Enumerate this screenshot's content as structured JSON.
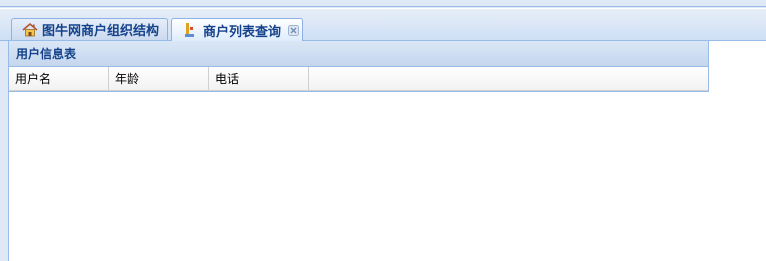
{
  "tabs": [
    {
      "label": "图牛网商户组织结构",
      "icon": "home-icon",
      "active": false
    },
    {
      "label": "商户列表查询",
      "icon": "grid-tree-icon",
      "active": true,
      "closable": true
    }
  ],
  "panel": {
    "title": "用户信息表",
    "columns": [
      "用户名",
      "年龄",
      "电话"
    ]
  },
  "colors": {
    "accent": "#15428b",
    "border": "#99bbe8",
    "background": "#dfe8f6"
  }
}
